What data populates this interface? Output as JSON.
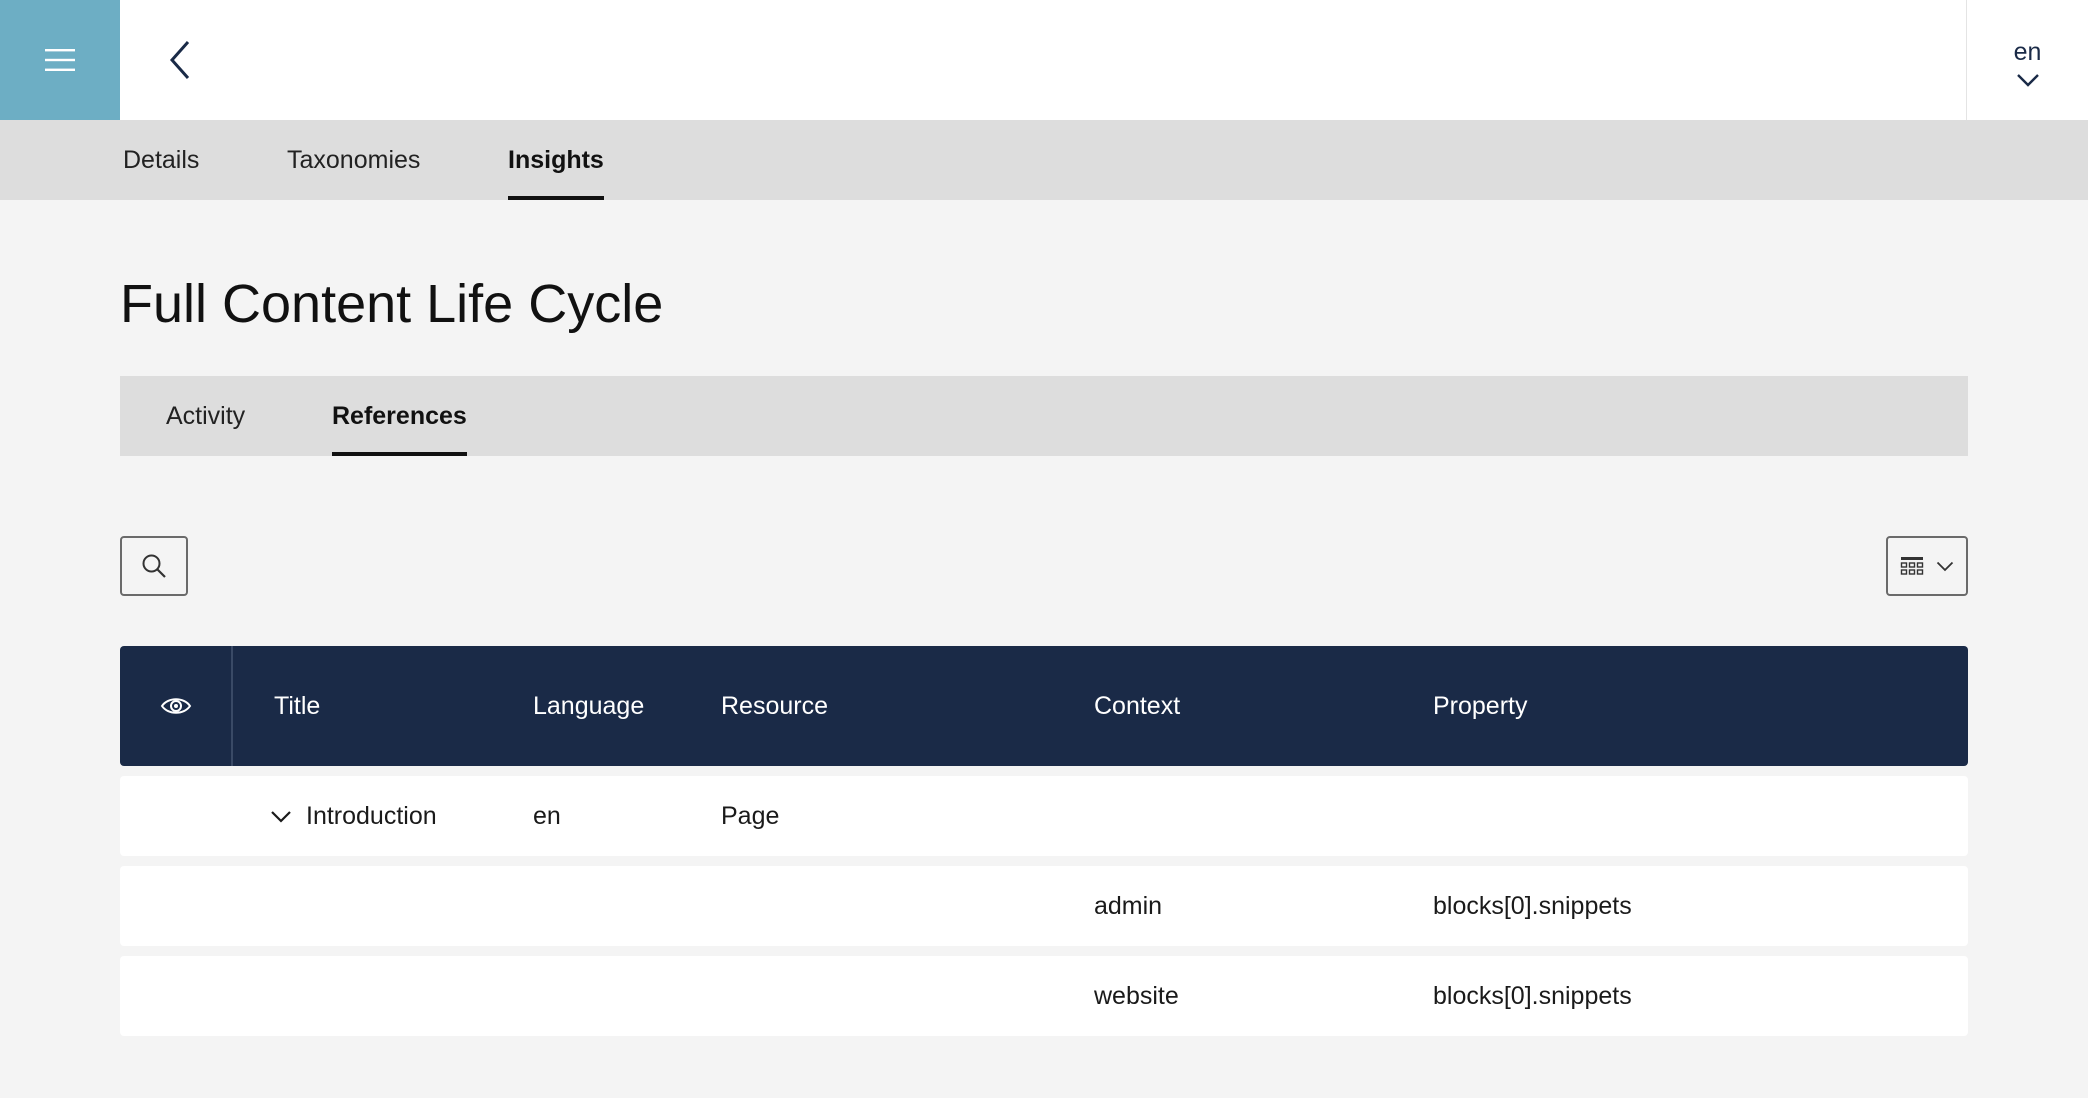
{
  "header": {
    "language": "en"
  },
  "main_tabs": [
    {
      "label": "Details"
    },
    {
      "label": "Taxonomies"
    },
    {
      "label": "Insights"
    }
  ],
  "page": {
    "title": "Full Content Life Cycle"
  },
  "sub_tabs": [
    {
      "label": "Activity"
    },
    {
      "label": "References"
    }
  ],
  "table": {
    "columns": [
      "Title",
      "Language",
      "Resource",
      "Context",
      "Property"
    ],
    "rows": [
      {
        "title": "Introduction",
        "language": "en",
        "resource": "Page",
        "context": "",
        "property": ""
      },
      {
        "title": "",
        "language": "",
        "resource": "",
        "context": "admin",
        "property": "blocks[0].snippets"
      },
      {
        "title": "",
        "language": "",
        "resource": "",
        "context": "website",
        "property": "blocks[0].snippets"
      }
    ]
  },
  "colors": {
    "accent": "#6daec4",
    "table_header": "#1a2a47",
    "tab_bar": "#dddddd",
    "background": "#f4f4f4"
  },
  "icons": {
    "menu": "hamburger-icon",
    "back": "chevron-left-icon",
    "language_dropdown": "chevron-down-icon",
    "search": "search-icon",
    "columns": "columns-grid-icon",
    "visibility": "eye-icon",
    "row_toggle": "chevron-down-icon"
  }
}
